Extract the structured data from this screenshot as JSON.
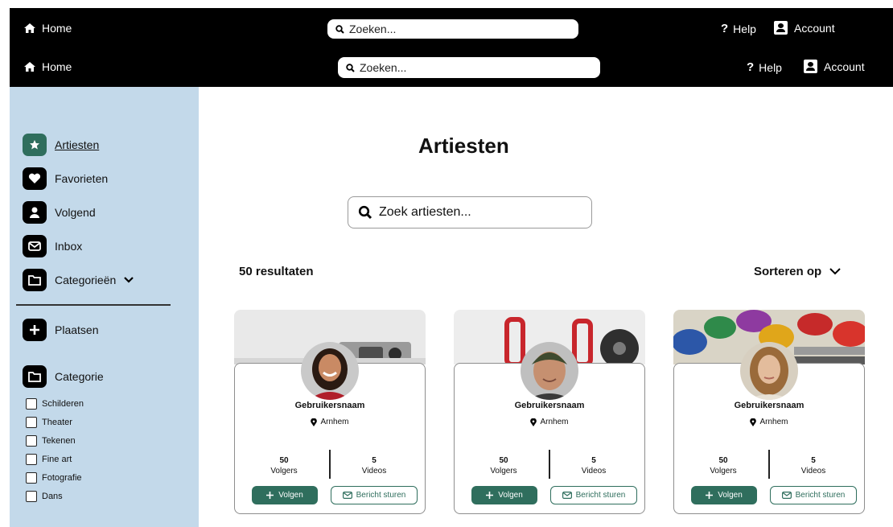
{
  "topbar": {
    "home_label": "Home",
    "search_placeholder": "Zoeken...",
    "help_label": "Help",
    "help_glyph": "?",
    "account_label": "Account"
  },
  "sidebar": {
    "items": [
      {
        "label": "Artiesten",
        "icon": "star-icon"
      },
      {
        "label": "Favorieten",
        "icon": "heart-icon"
      },
      {
        "label": "Volgend",
        "icon": "person-icon"
      },
      {
        "label": "Inbox",
        "icon": "mail-icon"
      },
      {
        "label": "Categorieën",
        "icon": "folder-icon"
      }
    ],
    "post_label": "Plaatsen",
    "category_title": "Categorie",
    "categories": [
      "Schilderen",
      "Theater",
      "Tekenen",
      "Fine art",
      "Fotografie",
      "Dans"
    ]
  },
  "main": {
    "title": "Artiesten",
    "search_placeholder": "Zoek artiesten...",
    "results": "50 resultaten",
    "sort_label": "Sorteren op"
  },
  "cards": [
    {
      "username": "Gebruikersnaam",
      "location": "Arnhem",
      "followers_count": "50",
      "followers_label": "Volgers",
      "videos_count": "5",
      "videos_label": "Videos",
      "follow_label": "Volgen",
      "message_label": "Bericht sturen"
    },
    {
      "username": "Gebruikersnaam",
      "location": "Arnhem",
      "followers_count": "50",
      "followers_label": "Volgers",
      "videos_count": "5",
      "videos_label": "Videos",
      "follow_label": "Volgen",
      "message_label": "Bericht sturen"
    },
    {
      "username": "Gebruikersnaam",
      "location": "Arnhem",
      "followers_count": "50",
      "followers_label": "Volgers",
      "videos_count": "5",
      "videos_label": "Videos",
      "follow_label": "Volgen",
      "message_label": "Bericht sturen"
    }
  ],
  "colors": {
    "accent": "#2f6e5d",
    "sidebar_bg": "#c3d9ea",
    "topbar_bg": "#000000"
  }
}
